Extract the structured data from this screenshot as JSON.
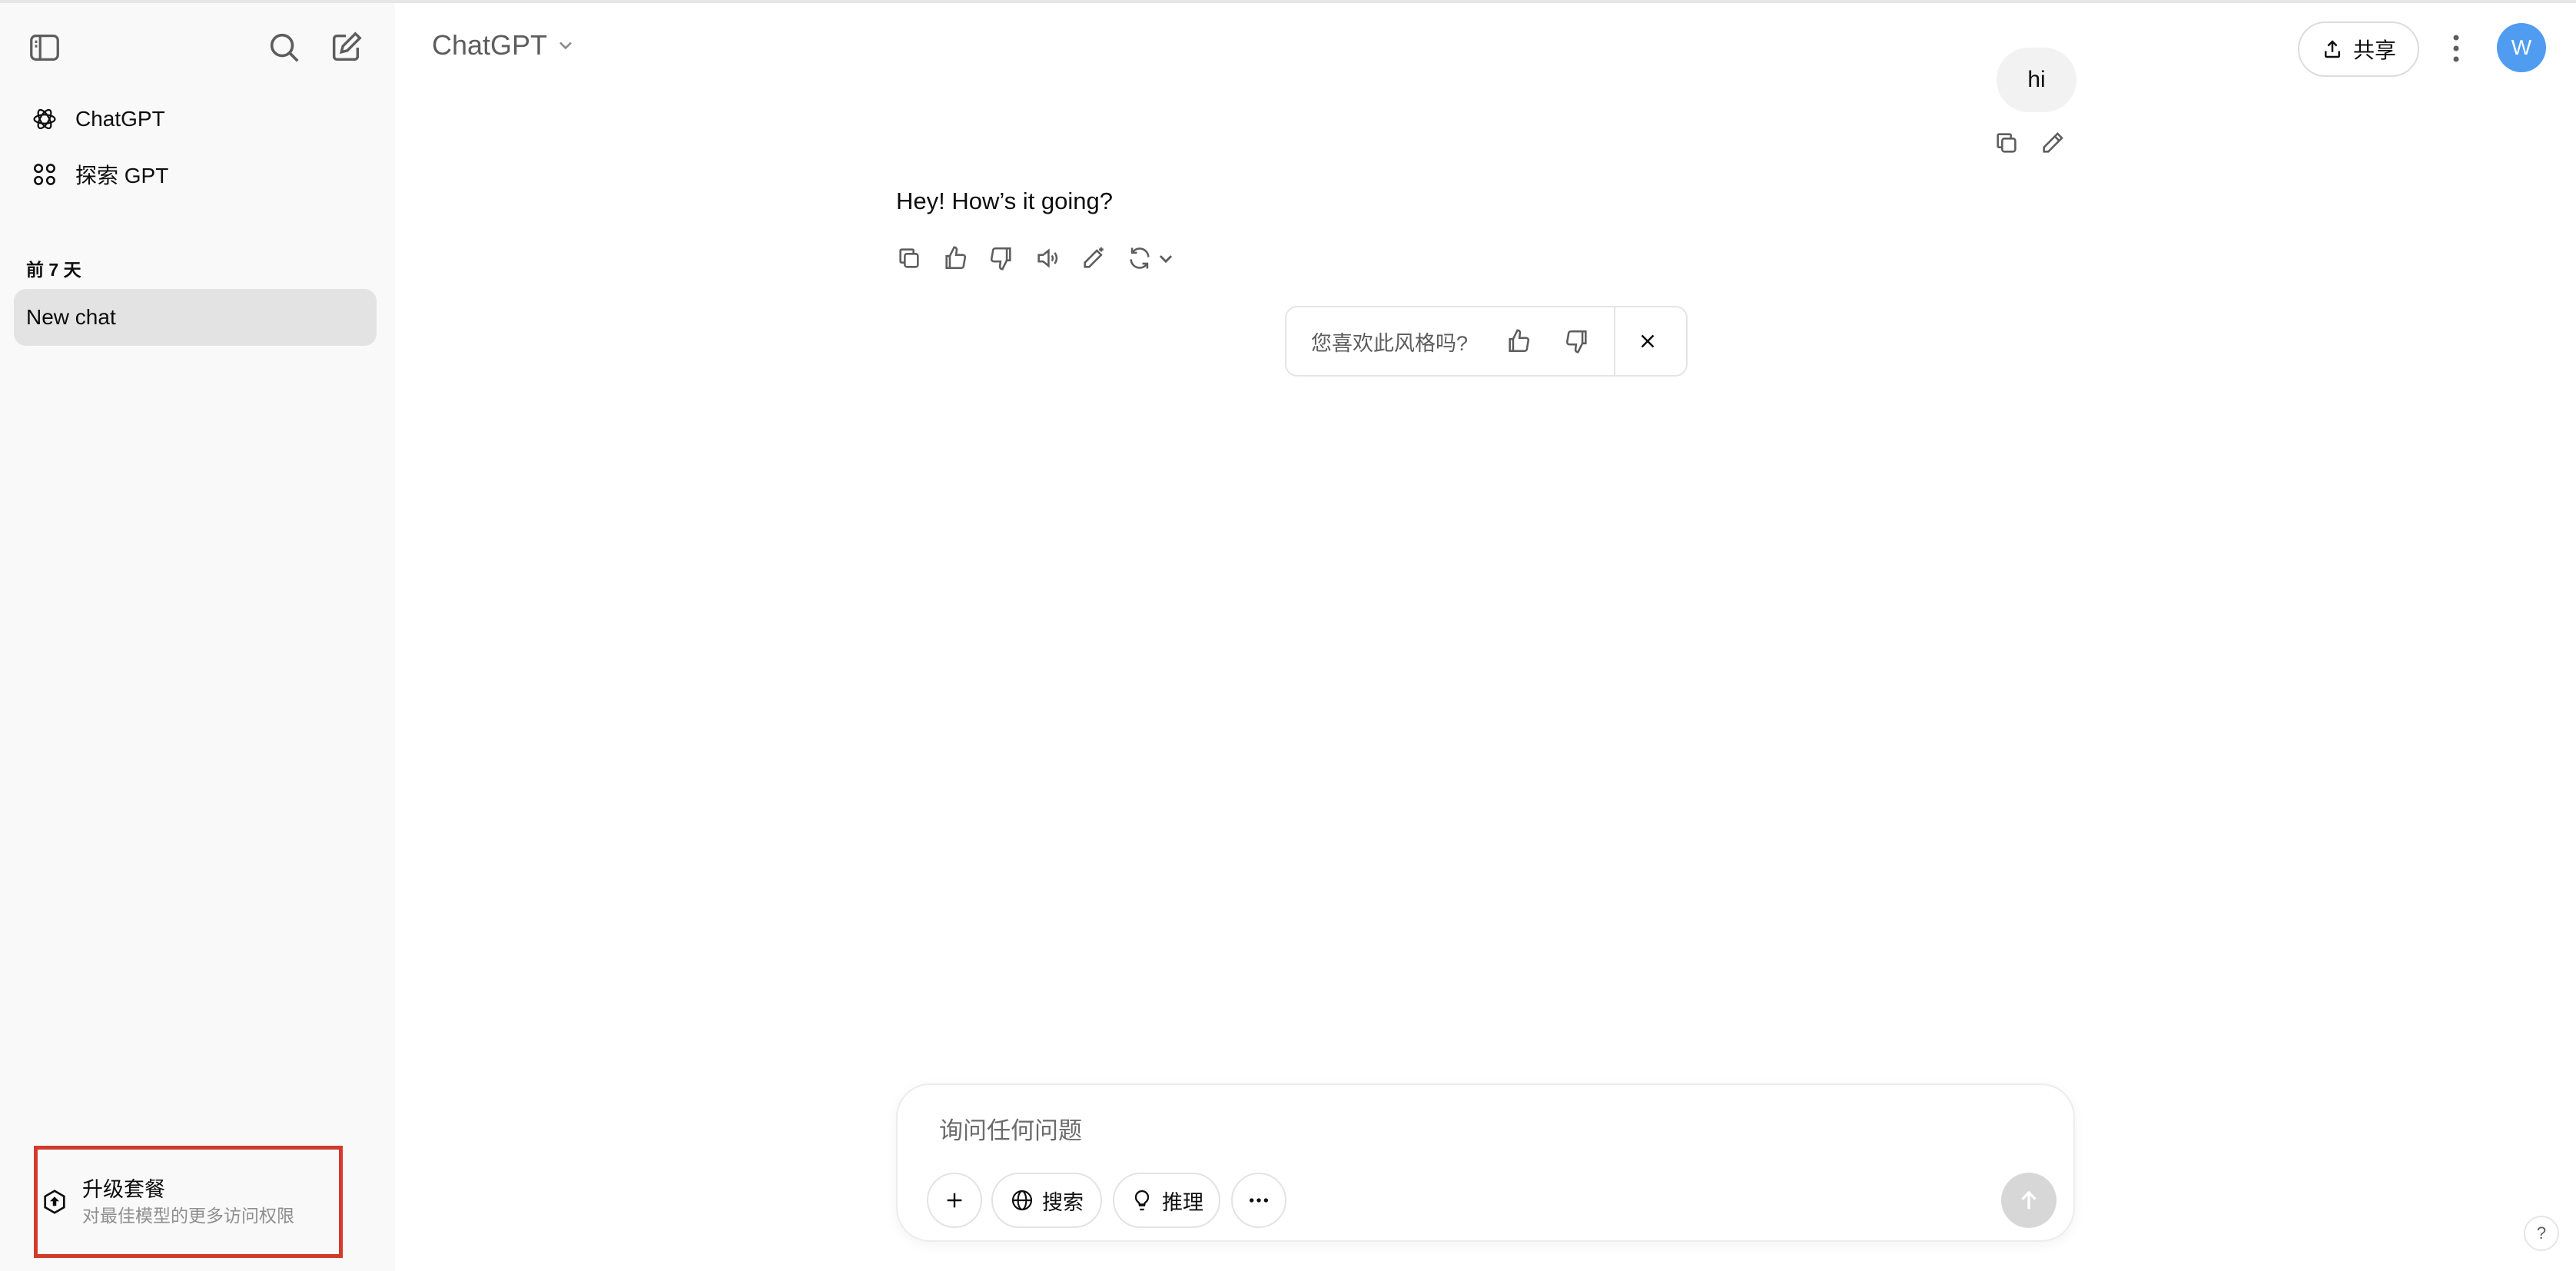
{
  "sidebar": {
    "nav": [
      {
        "label": "ChatGPT",
        "icon": "openai-logo-icon"
      },
      {
        "label": "探索 GPT",
        "icon": "grid-icon"
      }
    ],
    "section_label": "前 7 天",
    "chats": [
      {
        "label": "New chat"
      }
    ],
    "upgrade": {
      "title": "升级套餐",
      "subtitle": "对最佳模型的更多访问权限"
    }
  },
  "header": {
    "model_name": "ChatGPT",
    "share_label": "共享",
    "avatar_initial": "W"
  },
  "conversation": {
    "user_message": "hi",
    "assistant_message": "Hey! How’s it going?"
  },
  "feedback": {
    "question": "您喜欢此风格吗?"
  },
  "composer": {
    "placeholder": "询问任何问题",
    "search_label": "搜索",
    "reason_label": "推理"
  },
  "help": {
    "label": "?"
  },
  "colors": {
    "sidebar_bg": "#f9f9f9",
    "selected_chat_bg": "#e3e3e3",
    "avatar_bg": "#4f9cf1",
    "highlight_border": "#d23a2c"
  }
}
